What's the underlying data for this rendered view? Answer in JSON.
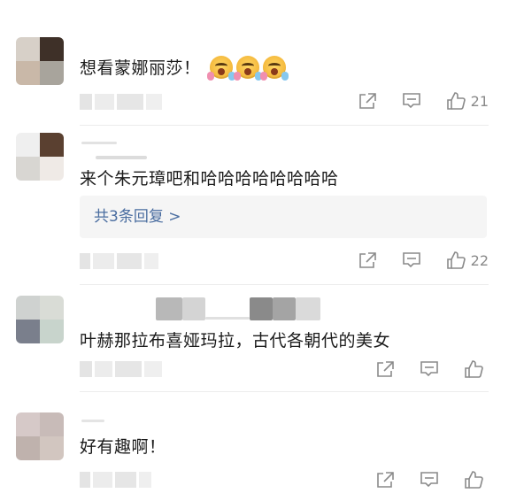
{
  "comments": [
    {
      "text": "想看蒙娜丽莎！",
      "emojis": [
        "crying-laugh-emoji",
        "crying-laugh-emoji",
        "crying-laugh-emoji"
      ],
      "like_count": "21",
      "avatar_colors": [
        "#d7d0c8",
        "#3e3028",
        "#c9b8a8",
        "#a8a49c"
      ]
    },
    {
      "text": "来个朱元璋吧和哈哈哈哈哈哈哈哈",
      "replies_label": "共3条回复 >",
      "like_count": "22",
      "avatar_colors": [
        "#efefef",
        "#5a4030",
        "#d8d6d2",
        "#efeae6"
      ]
    },
    {
      "text": "叶赫那拉布喜娅玛拉，古代各朝代的美女",
      "like_count": "",
      "avatar_colors": [
        "#cfd2d0",
        "#d9dcd6",
        "#7a7f8c",
        "#c8d4cc"
      ]
    },
    {
      "text": "好有趣啊！",
      "like_count": "",
      "avatar_colors": [
        "#d6c9c8",
        "#c8bbb8",
        "#bfb2ad",
        "#d2c6c0"
      ]
    }
  ],
  "icons": {
    "share": "share-icon",
    "comment": "comment-icon",
    "like": "thumbs-up-icon"
  },
  "colors": {
    "text": "#1a1a1a",
    "meta": "#8a8a8a",
    "link": "#4a6da0",
    "reply_bg": "#f5f5f5"
  }
}
